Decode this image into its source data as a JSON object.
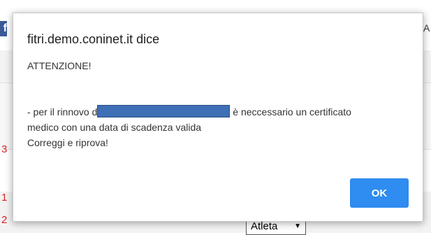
{
  "background": {
    "facebook_icon": "f",
    "right_text": "A",
    "row_numbers": [
      "3",
      "1",
      "2"
    ],
    "select_value": "Atleta"
  },
  "dialog": {
    "origin": "fitri.demo.coninet.it dice",
    "heading": "ATTENZIONE!",
    "line1_prefix": "- per il rinnovo d",
    "line1_suffix": "è neccessario un certificato",
    "line2": "medico con una data di scadenza valida",
    "line3": "Correggi e riprova!",
    "ok_label": "OK"
  },
  "colors": {
    "accent": "#2f8cf0",
    "redaction": "#3f6fb5",
    "error_red": "#d22222"
  }
}
